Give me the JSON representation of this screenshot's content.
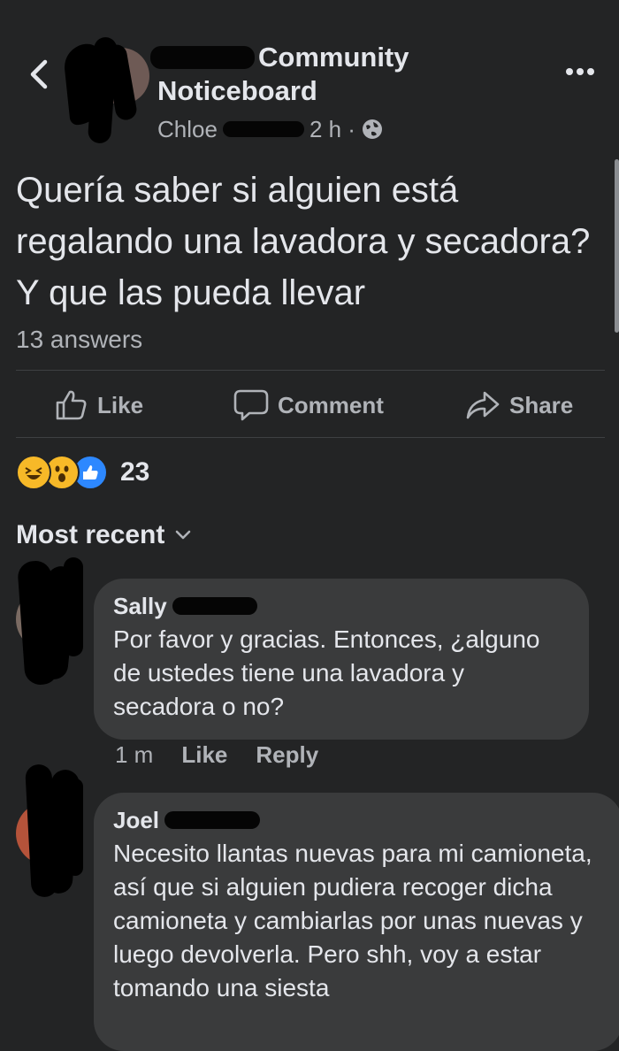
{
  "header": {
    "group_name_line1": "Community",
    "group_name_line2": "Noticeboard",
    "author": "Chloe",
    "time": "2 h ·"
  },
  "post": {
    "text": "Quería saber si alguien está regalando una lavadora y secadora? Y que las pueda llevar",
    "answers": "13 answers"
  },
  "actions": {
    "like": "Like",
    "comment": "Comment",
    "share": "Share"
  },
  "reactions": {
    "count": "23",
    "types": [
      "laugh",
      "wow",
      "like"
    ]
  },
  "sort": {
    "label": "Most recent"
  },
  "comments": [
    {
      "name": "Sally",
      "text": "Por favor y gracias. Entonces, ¿alguno de ustedes tiene una lavadora y secadora o no?",
      "time": "1 m",
      "like": "Like",
      "reply": "Reply"
    },
    {
      "name": "Joel",
      "text": "Necesito llantas nuevas para mi camioneta, así que si alguien pudiera recoger dicha camioneta y cambiarlas por unas nuevas y luego devolverla. Pero shh, voy a estar tomando una siesta"
    }
  ],
  "colors": {
    "background": "#232425",
    "bubble": "#3a3b3c",
    "text_primary": "#e4e6eb",
    "text_secondary": "#b0b3b8",
    "like_blue": "#2d88ff",
    "reaction_yellow": "#f7b928"
  }
}
